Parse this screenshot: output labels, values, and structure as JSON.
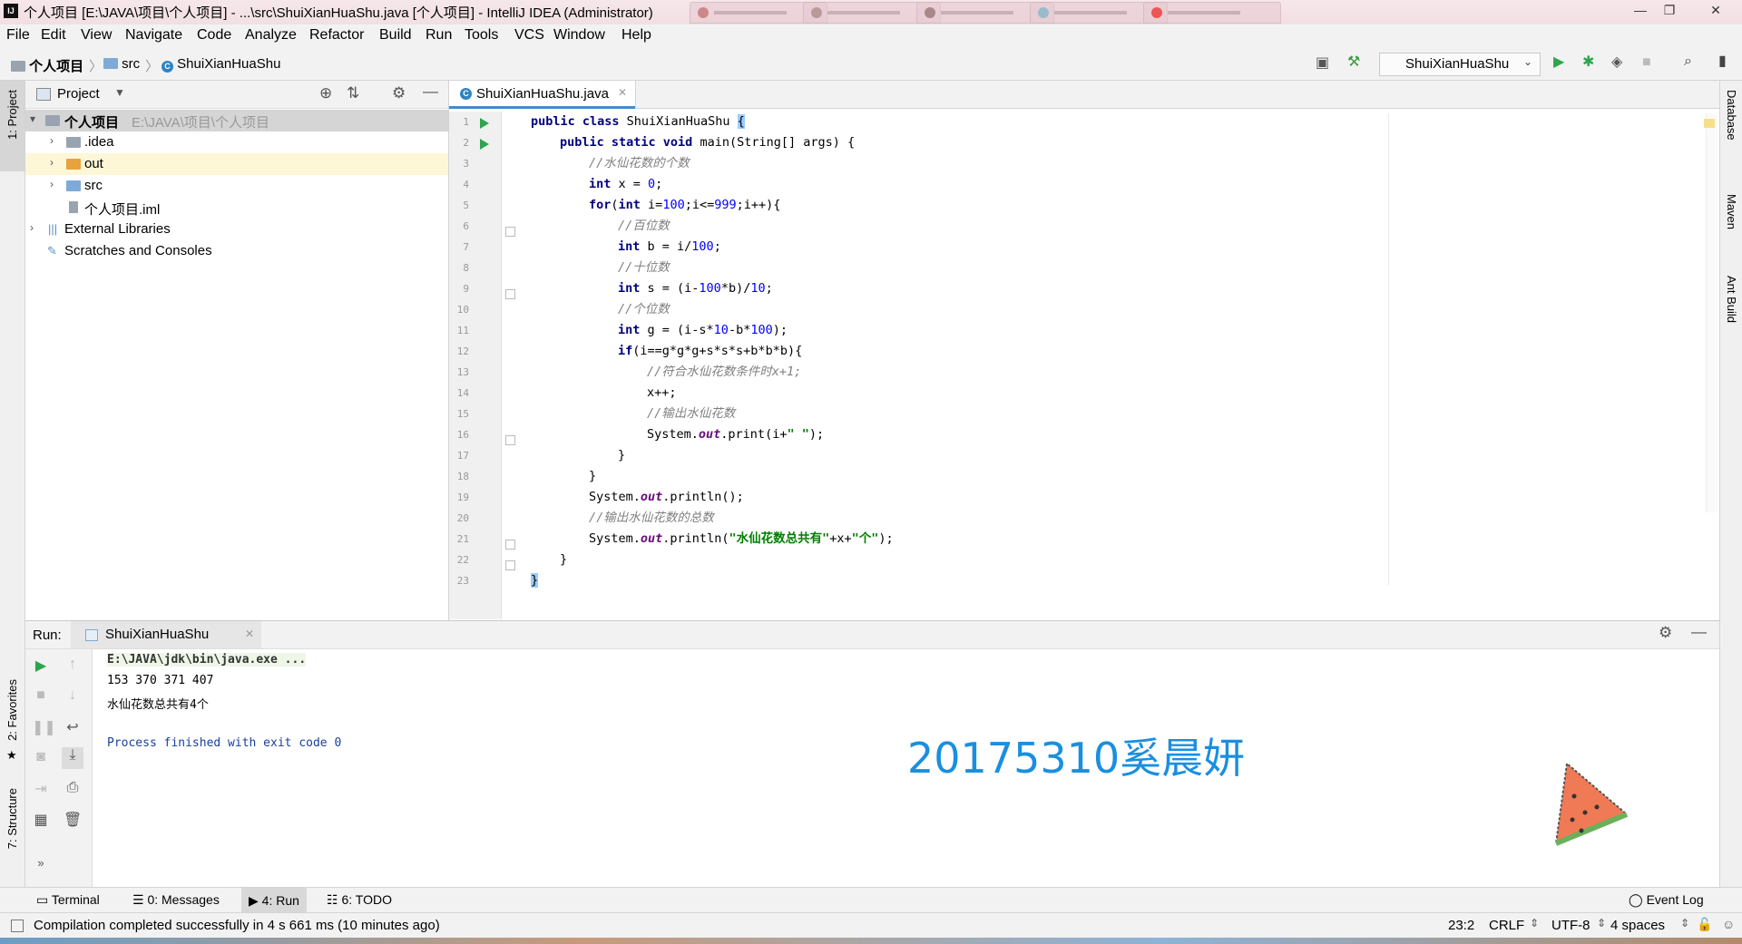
{
  "window": {
    "title": "个人项目 [E:\\JAVA\\项目\\个人项目] - ...\\src\\ShuiXianHuaShu.java [个人项目] - IntelliJ IDEA (Administrator)",
    "app_icon_text": "IJ"
  },
  "menu": [
    "File",
    "Edit",
    "View",
    "Navigate",
    "Code",
    "Analyze",
    "Refactor",
    "Build",
    "Run",
    "Tools",
    "VCS",
    "Window",
    "Help"
  ],
  "breadcrumb": {
    "project": "个人项目",
    "folder": "src",
    "file": "ShuiXianHuaShu"
  },
  "toolbar": {
    "run_config": "ShuiXianHuaShu"
  },
  "left_strip": {
    "project": "1: Project",
    "favorites": "2: Favorites",
    "structure": "7: Structure"
  },
  "right_strip": {
    "database": "Database",
    "maven": "Maven",
    "ant": "Ant Build"
  },
  "project_panel": {
    "title": "Project",
    "root_name": "个人项目",
    "root_path": "E:\\JAVA\\项目\\个人项目",
    "items": [
      ".idea",
      "out",
      "src",
      "个人项目.iml"
    ],
    "external": "External Libraries",
    "scratches": "Scratches and Consoles"
  },
  "editor": {
    "tab": "ShuiXianHuaShu.java",
    "line_numbers": [
      "1",
      "2",
      "3",
      "4",
      "5",
      "6",
      "7",
      "8",
      "9",
      "10",
      "11",
      "12",
      "13",
      "14",
      "15",
      "16",
      "17",
      "18",
      "19",
      "20",
      "21",
      "22",
      "23"
    ],
    "code": {
      "l1_kw": "public class ",
      "l1_name": "ShuiXianHuaShu ",
      "l1_brace": "{",
      "l2_kw": "public static void ",
      "l2_rest": "main(String[] args) {",
      "l3": "//水仙花数的个数",
      "l4_kw": "int ",
      "l4_a": "x = ",
      "l4_n": "0",
      "l4_b": ";",
      "l5_kw": "for",
      "l5_a": "(",
      "l5_kw2": "int ",
      "l5_b": "i=",
      "l5_n1": "100",
      "l5_c": ";i<=",
      "l5_n2": "999",
      "l5_d": ";i++){",
      "l6": "//百位数",
      "l7_kw": "int ",
      "l7_a": "b = i/",
      "l7_n": "100",
      "l7_b": ";",
      "l8": "//十位数",
      "l9_kw": "int ",
      "l9_a": "s = (i-",
      "l9_n1": "100",
      "l9_b": "*b)/",
      "l9_n2": "10",
      "l9_c": ";",
      "l10": "//个位数",
      "l11_kw": "int ",
      "l11_a": "g = (i-s*",
      "l11_n1": "10",
      "l11_b": "-b*",
      "l11_n2": "100",
      "l11_c": ");",
      "l12_kw": "if",
      "l12_a": "(i==g*g*g+s*s*s+b*b*b){",
      "l13": "//符合水仙花数条件时x+1;",
      "l14": "x++;",
      "l15": "//输出水仙花数",
      "l16_a": "System.",
      "l16_f": "out",
      "l16_b": ".print(i+",
      "l16_s": "\" \"",
      "l16_c": ");",
      "l17": "}",
      "l18": "}",
      "l19_a": "System.",
      "l19_f": "out",
      "l19_b": ".println();",
      "l20": "//输出水仙花数的总数",
      "l21_a": "System.",
      "l21_f": "out",
      "l21_b": ".println(",
      "l21_s1": "\"水仙花数总共有\"",
      "l21_c": "+x+",
      "l21_s2": "\"个\"",
      "l21_d": ");",
      "l22": "}",
      "l23": "}"
    }
  },
  "run_panel": {
    "label": "Run:",
    "tab": "ShuiXianHuaShu",
    "console": [
      "E:\\JAVA\\jdk\\bin\\java.exe ...",
      "153 370 371 407",
      "水仙花数总共有4个",
      "",
      "Process finished with exit code 0"
    ]
  },
  "watermark": "20175310奚晨妍",
  "bottom_tabs": {
    "terminal": "Terminal",
    "messages": "0: Messages",
    "run": "4: Run",
    "todo": "6: TODO",
    "event_log": "Event Log"
  },
  "status": {
    "message": "Compilation completed successfully in 4 s 661 ms (10 minutes ago)",
    "position": "23:2",
    "line_sep": "CRLF",
    "encoding": "UTF-8",
    "indent": "4 spaces"
  }
}
